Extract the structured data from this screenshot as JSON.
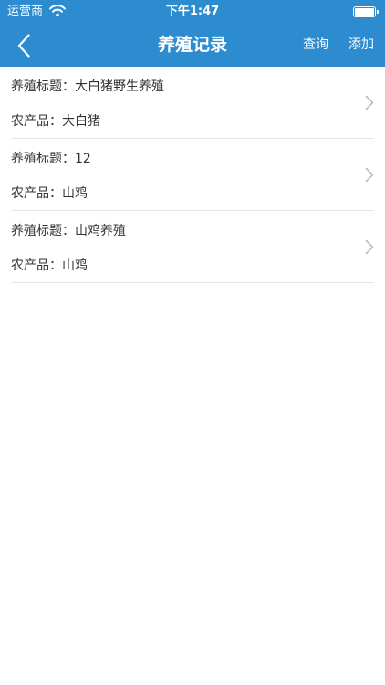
{
  "status_bar": {
    "carrier": "运营商",
    "time": "下午1:47"
  },
  "nav": {
    "title": "养殖记录",
    "query_label": "查询",
    "add_label": "添加"
  },
  "records": [
    {
      "title_label": "养殖标题：大白猪野生养殖",
      "product_label": "农产品：大白猪"
    },
    {
      "title_label": "养殖标题：12",
      "product_label": "农产品：山鸡"
    },
    {
      "title_label": "养殖标题：山鸡养殖",
      "product_label": "农产品：山鸡"
    }
  ],
  "colors": {
    "header_bg": "#2c8ccf",
    "divider": "#e5e5e5",
    "chevron": "#b5b5b5"
  },
  "icons": {
    "back": "chevron-left-icon",
    "wifi": "wifi-icon",
    "battery": "battery-icon",
    "row_arrow": "chevron-right-icon"
  }
}
